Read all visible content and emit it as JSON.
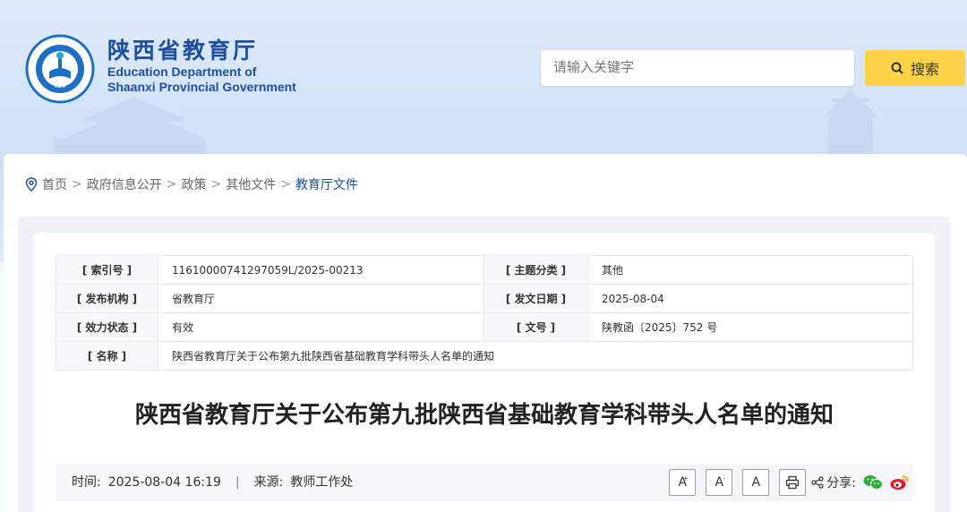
{
  "header": {
    "logo_text": "EDUCATION DEPARTMENT OF SHAANXI · 陕西省教育厅",
    "brand_cn": "陕西省教育厅",
    "brand_en_line1": "Education Department of",
    "brand_en_line2": "Shaanxi Provincial Government",
    "search_placeholder": "请输入关键字",
    "search_button": "搜索",
    "accent_color": "#1d4fa0",
    "button_color": "#ffd24a"
  },
  "breadcrumb": {
    "items": [
      "首页",
      "政府信息公开",
      "政策",
      "其他文件"
    ],
    "current": "教育厅文件",
    "separator": ">"
  },
  "meta": {
    "index_label": "[ 索引号 ]",
    "index_value": "11610000741297059L/2025-00213",
    "topic_label": "[ 主题分类 ]",
    "topic_value": "其他",
    "publisher_label": "[ 发布机构 ]",
    "publisher_value": "省教育厅",
    "date_label": "[ 发文日期 ]",
    "date_value": "2025-08-04",
    "status_label": "[ 效力状态 ]",
    "status_value": "有效",
    "docno_label": "[ 文号 ]",
    "docno_value": "陕教函〔2025〕752  号",
    "name_label": "[ 名称 ]",
    "name_value": "陕西省教育厅关于公布第九批陕西省基础教育学科带头人名单的通知"
  },
  "article": {
    "title": "陕西省教育厅关于公布第九批陕西省基础教育学科带头人名单的通知",
    "time_label": "时间:",
    "time_value": "2025-08-04 16:19",
    "divider": "|",
    "source_label": "来源:",
    "source_value": "教师工作处",
    "font_large": "A",
    "font_small": "A",
    "font_reset": "A",
    "share_label": "分享:"
  },
  "icons": [
    "location-pin-icon",
    "search-icon",
    "print-icon",
    "share-icon",
    "wechat-icon",
    "weibo-icon"
  ]
}
